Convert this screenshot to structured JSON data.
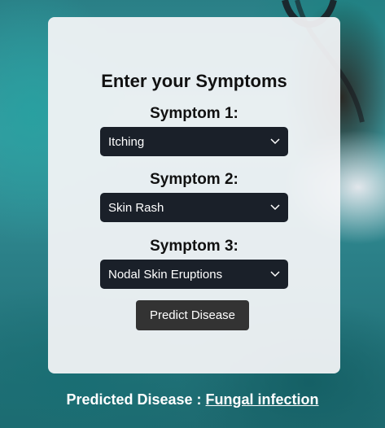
{
  "form": {
    "title": "Enter your Symptoms",
    "symptom1": {
      "label": "Symptom 1:",
      "value": "Itching"
    },
    "symptom2": {
      "label": "Symptom 2:",
      "value": "Skin Rash"
    },
    "symptom3": {
      "label": "Symptom 3:",
      "value": "Nodal Skin Eruptions"
    },
    "button_label": "Predict Disease"
  },
  "result": {
    "label": "Predicted Disease : ",
    "value": "Fungal infection"
  },
  "icons": {
    "select_arrow": "chevron-down-icon"
  },
  "colors": {
    "select_bg": "#1a2029",
    "button_bg": "#333333",
    "card_bg": "#f5f5f7"
  }
}
